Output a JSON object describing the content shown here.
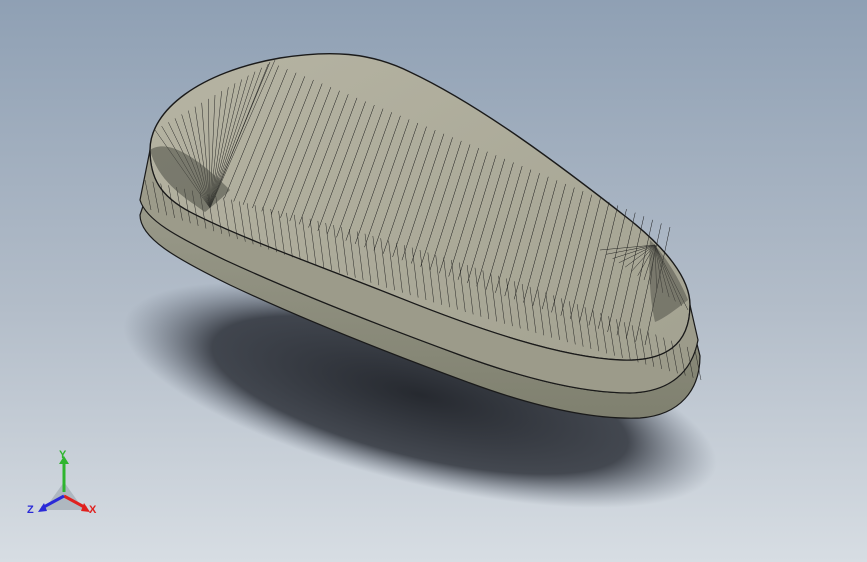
{
  "viewport": {
    "background_top": "#8fa0b4",
    "background_bottom": "#d7dde3"
  },
  "model": {
    "face_color": "#a9a897",
    "edge_color": "#1a1a1a",
    "shadow_color": "#2a2d33"
  },
  "triad": {
    "x_label": "X",
    "y_label": "Y",
    "z_label": "Z",
    "x_color": "#e0201e",
    "y_color": "#2fb52f",
    "z_color": "#2a2ad8"
  }
}
